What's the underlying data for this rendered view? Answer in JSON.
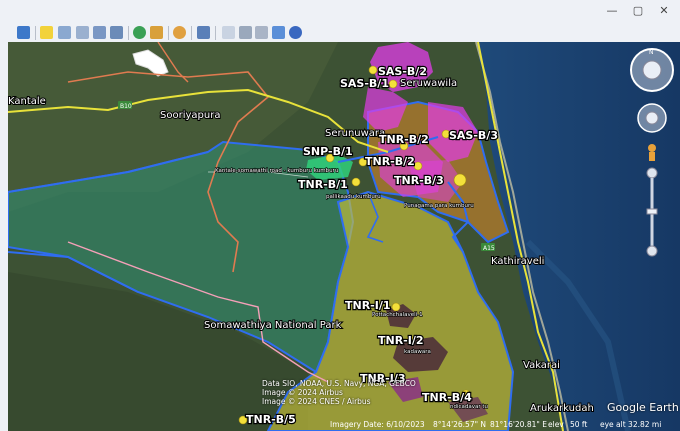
{
  "window": {
    "controls": {
      "minimize": "—",
      "maximize": "▢",
      "close": "✕"
    }
  },
  "colors": {
    "toolbar_bg": "#eef1f6",
    "river_border": "#2f6df0",
    "yellow_block": "#c9c23a",
    "teal_block": "#2f8f74",
    "magenta_block": "#e23ce8",
    "orange_block": "#e08a2a",
    "road": "#e8e23a",
    "admin_boundary": "#e07b50",
    "park_boundary": "#f4a0b8"
  },
  "map": {
    "place_labels": [
      "Kantale",
      "Sooriyapura",
      "Seruwawila",
      "Serunuwara",
      "Somawathiya National Park",
      "Kathiraveli",
      "Vakarai",
      "Arukarkudah"
    ],
    "road_labels": [
      "B10",
      "A15"
    ],
    "block_labels": [
      "SAS-B/2",
      "SAS-B/1",
      "TNR-B/2",
      "SAS-B/3",
      "SNP-B/1",
      "TNR-B/2",
      "TNR-B/1",
      "TNR-B/3",
      "TNR-I/1",
      "TNR-I/2",
      "TNR-I/3",
      "TNR-B/4",
      "TNR-B/5"
    ],
    "small_labels": [
      "Kantale-somawathi road - kumburu kumburu",
      "pallikaadu kumburu",
      "Punagama para kumburu",
      "Pottachchalaveli-1",
      "kadawara",
      "ndicadavar tu"
    ],
    "credits": [
      "Data SIO, NOAA, U.S. Navy, NGA, GEBCO",
      "Image © 2024 Airbus",
      "Image © 2024 CNES / Airbus"
    ],
    "logo": "Google Earth"
  },
  "status": {
    "imagery_date": "Imagery Date: 6/10/2023",
    "lat": "8°14'26.57\" N",
    "lon": "81°16'20.81\" E",
    "elev_label": "elev",
    "elev_value": "50 ft",
    "eye_alt": "eye alt  32.82 mi"
  },
  "nav": {
    "north": "N"
  }
}
